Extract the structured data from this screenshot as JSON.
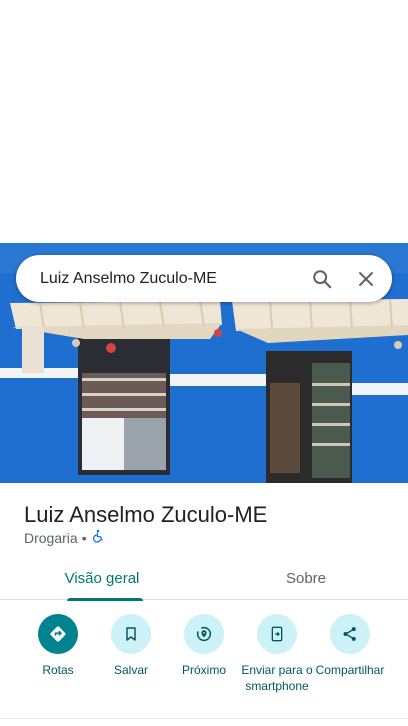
{
  "search": {
    "query": "Luiz Anselmo Zuculo-ME"
  },
  "place": {
    "name": "Luiz Anselmo Zuculo-ME",
    "category": "Drogaria",
    "separator": "•"
  },
  "tabs": [
    {
      "label": "Visão geral",
      "active": true
    },
    {
      "label": "Sobre",
      "active": false
    }
  ],
  "actions": [
    {
      "label": "Rotas",
      "icon": "directions-icon"
    },
    {
      "label": "Salvar",
      "icon": "bookmark-icon"
    },
    {
      "label": "Próximo",
      "icon": "nearby-icon"
    },
    {
      "label": "Enviar para o smartphone",
      "icon": "send-to-phone-icon"
    },
    {
      "label": "Compartilhar",
      "icon": "share-icon"
    }
  ],
  "colors": {
    "accent": "#00796b",
    "action_bg": "#ccf1f6",
    "primary_action_bg": "#00838f",
    "wall_blue": "#1f6fd0"
  }
}
